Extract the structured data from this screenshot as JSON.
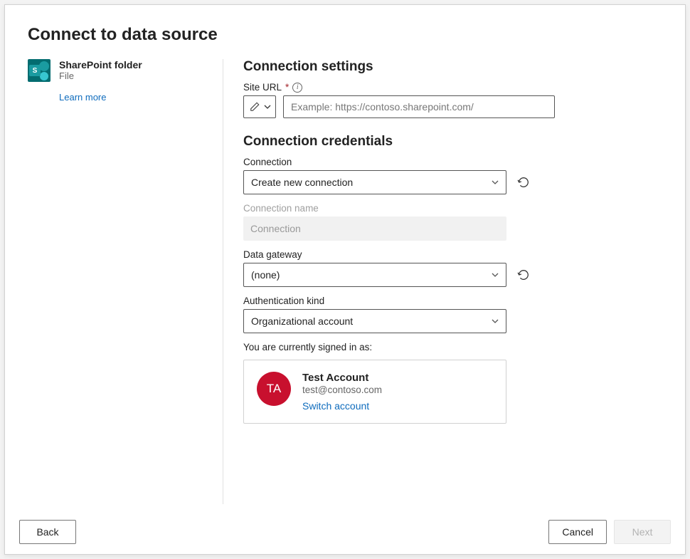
{
  "title": "Connect to data source",
  "source": {
    "name": "SharePoint folder",
    "category": "File",
    "iconLetter": "S",
    "learnMore": "Learn more"
  },
  "settings": {
    "heading": "Connection settings",
    "siteUrl": {
      "label": "Site URL",
      "placeholder": "Example: https://contoso.sharepoint.com/",
      "value": ""
    }
  },
  "credentials": {
    "heading": "Connection credentials",
    "connection": {
      "label": "Connection",
      "value": "Create new connection"
    },
    "connectionName": {
      "label": "Connection name",
      "value": "Connection"
    },
    "gateway": {
      "label": "Data gateway",
      "value": "(none)"
    },
    "authKind": {
      "label": "Authentication kind",
      "value": "Organizational account"
    },
    "signedInLabel": "You are currently signed in as:",
    "account": {
      "initials": "TA",
      "displayName": "Test Account",
      "email": "test@contoso.com",
      "switchLabel": "Switch account"
    }
  },
  "footer": {
    "back": "Back",
    "cancel": "Cancel",
    "next": "Next"
  }
}
